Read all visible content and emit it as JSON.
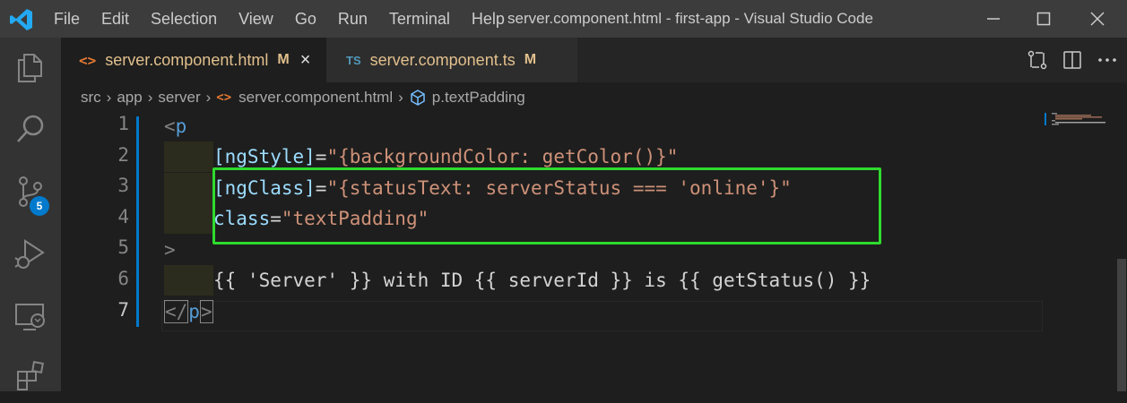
{
  "menu": [
    "File",
    "Edit",
    "Selection",
    "View",
    "Go",
    "Run",
    "Terminal",
    "Help"
  ],
  "window_title": "server.component.html - first-app - Visual Studio Code",
  "activity": {
    "source_control_badge": "5"
  },
  "tabs": [
    {
      "icon": "<>",
      "label": "server.component.html",
      "modified": "M",
      "close": "×"
    },
    {
      "icon": "TS",
      "label": "server.component.ts",
      "modified": "M"
    }
  ],
  "breadcrumb": [
    "src",
    "app",
    "server",
    "server.component.html",
    "p.textPadding"
  ],
  "line_numbers": [
    "1",
    "2",
    "3",
    "4",
    "5",
    "6",
    "7"
  ],
  "code": {
    "l1": {
      "open": "<",
      "tag": "p"
    },
    "l2": {
      "attr": "[ngStyle]",
      "eq": "=",
      "val": "\"{backgroundColor: getColor()}\""
    },
    "l3": {
      "attr": "[ngClass]",
      "eq": "=",
      "val": "\"{statusText: serverStatus === 'online'}\""
    },
    "l4": {
      "attr": "class",
      "eq": "=",
      "val": "\"textPadding\""
    },
    "l5": {
      "close": ">"
    },
    "l6": {
      "text": "{{ 'Server' }} with ID {{ serverId }} is {{ getStatus() }}"
    },
    "l7": {
      "open": "</",
      "tag": "p",
      "close": ">"
    }
  },
  "colors": {
    "highlight_box": "#2edb2e",
    "accent": "#007acc",
    "tag": "#569cd6",
    "attribute": "#9cdcfe",
    "string": "#ce9178",
    "modified": "#e2c08d"
  }
}
